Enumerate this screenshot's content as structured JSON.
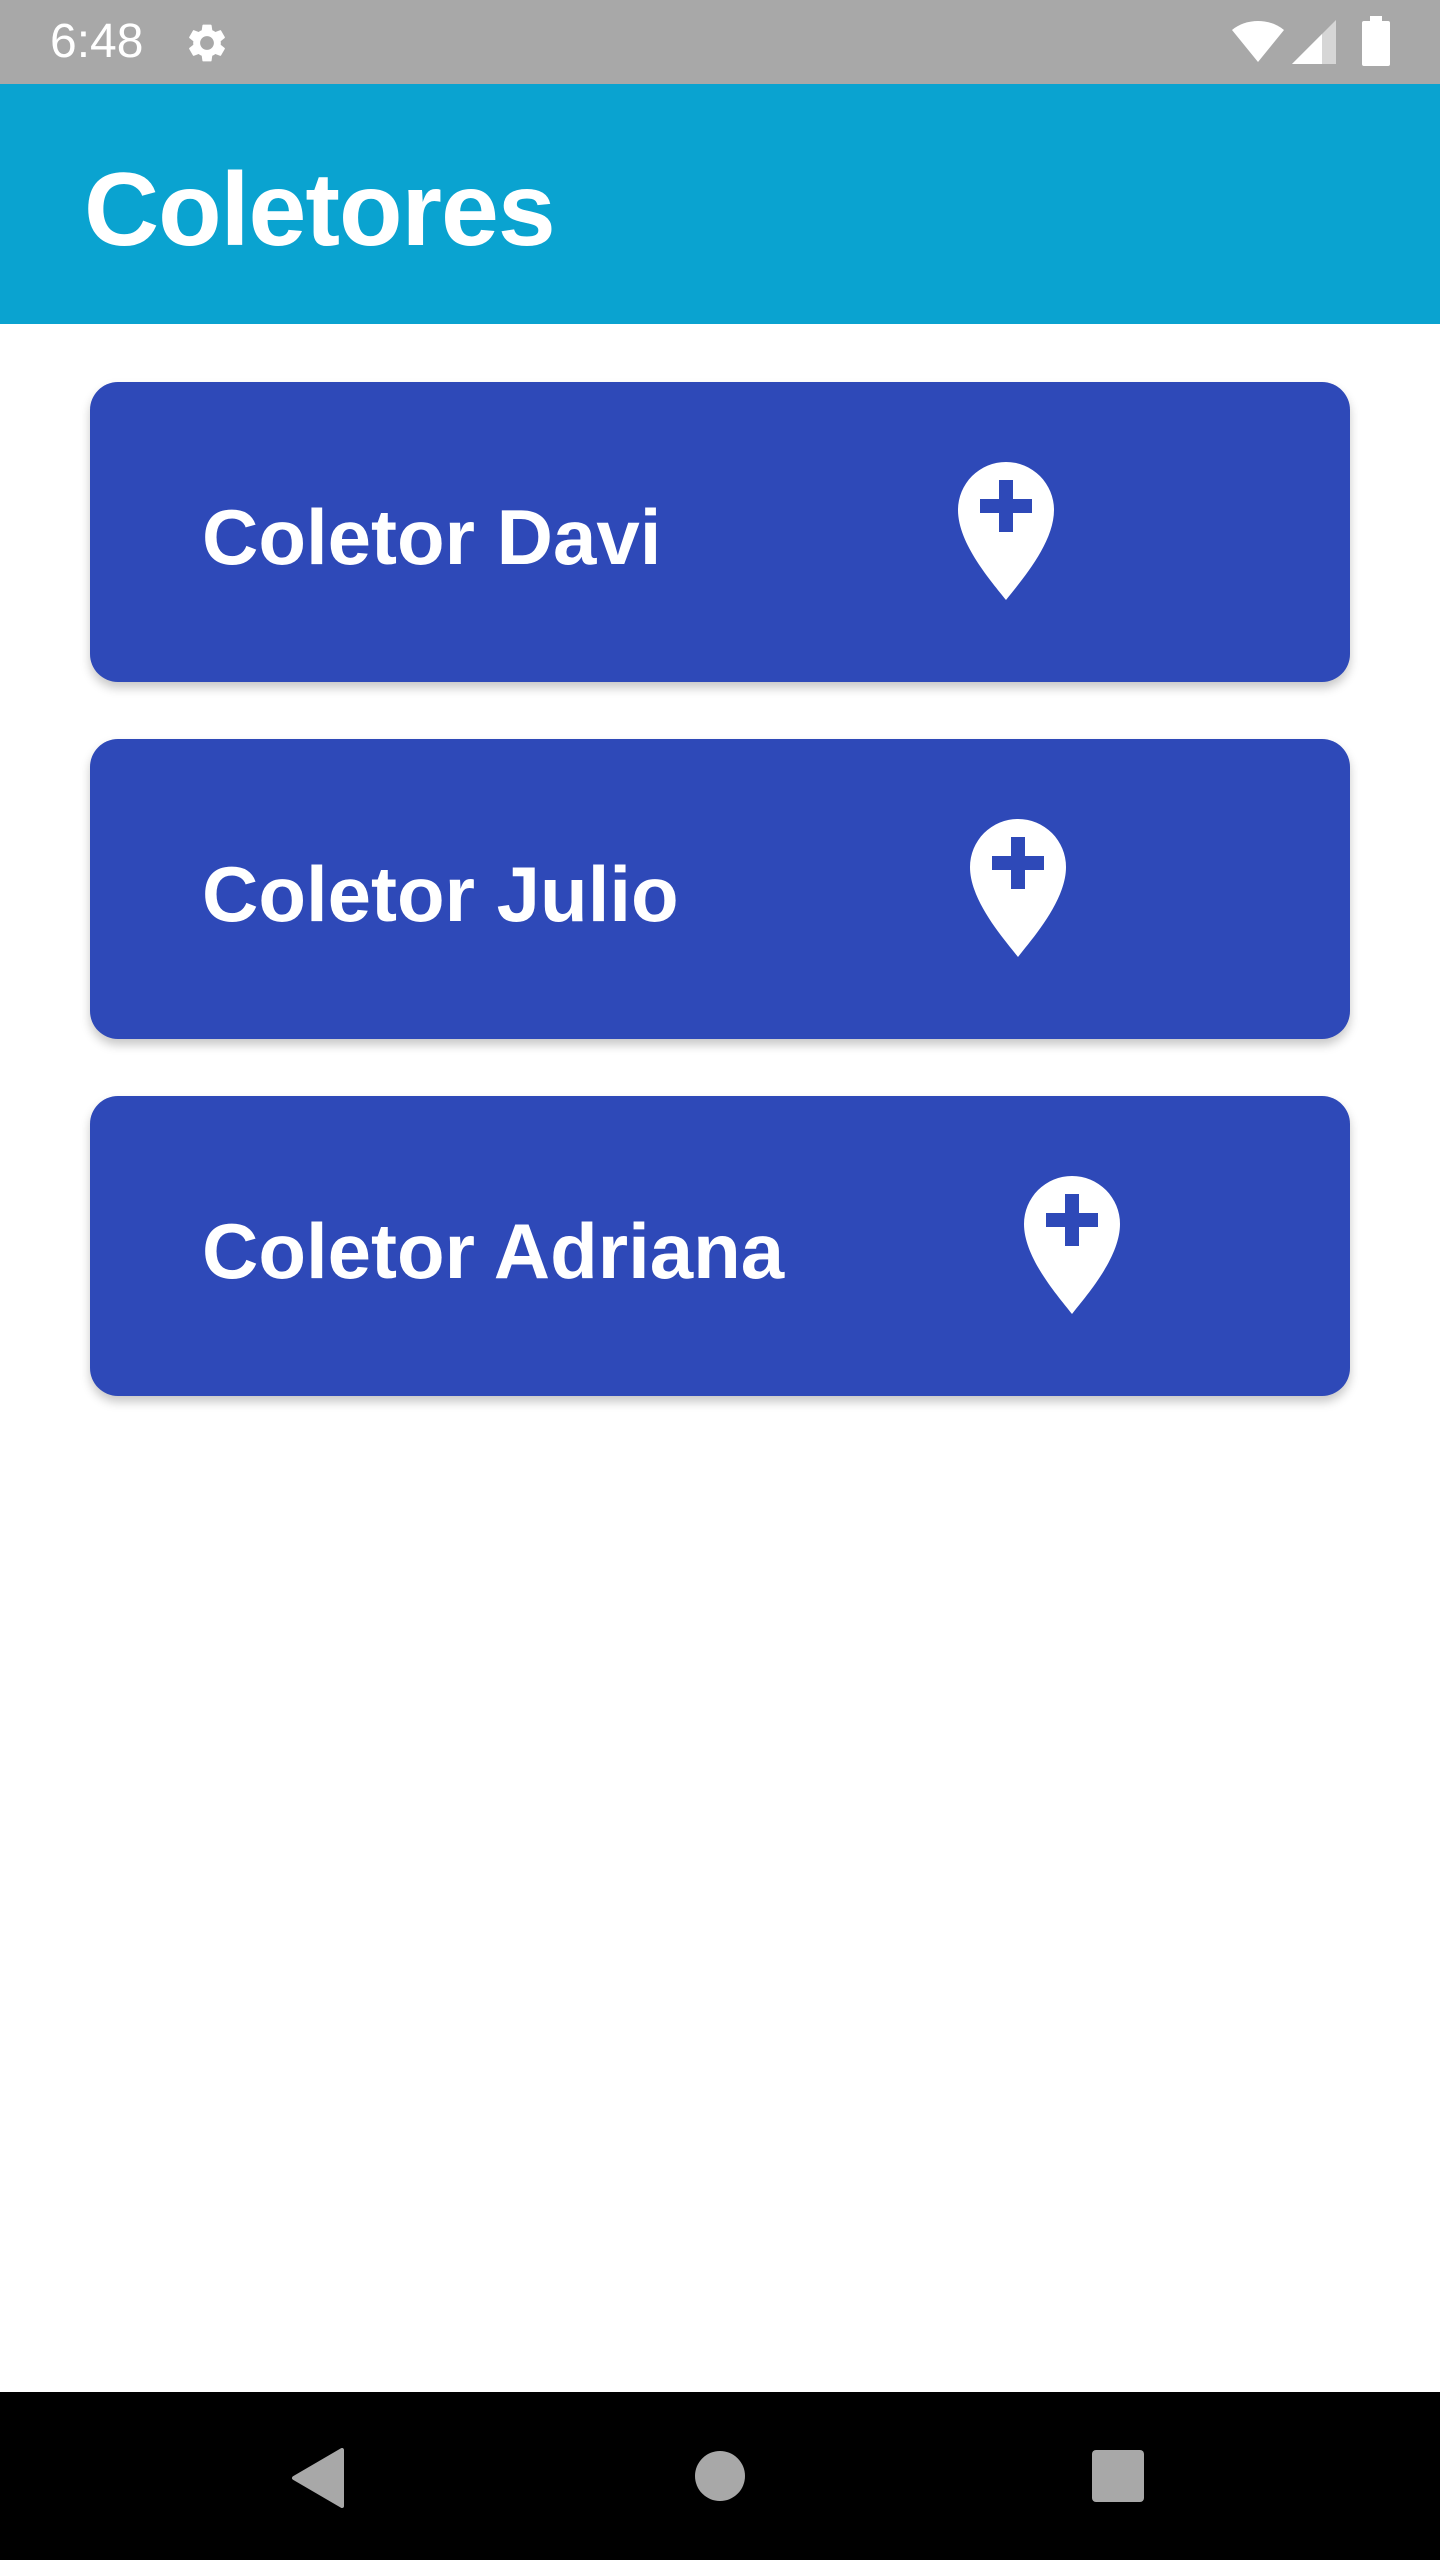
{
  "status_bar": {
    "time": "6:48",
    "icons": [
      "gear-icon",
      "wifi-icon",
      "cell-signal-icon",
      "battery-icon"
    ]
  },
  "app_bar": {
    "title": "Coletores",
    "color": "#0aa3d0"
  },
  "collectors": [
    {
      "label": "Coletor Davi",
      "icon": "add-location-icon"
    },
    {
      "label": "Coletor Julio",
      "icon": "add-location-icon"
    },
    {
      "label": "Coletor Adriana",
      "icon": "add-location-icon"
    }
  ],
  "colors": {
    "card": "#2e49b8",
    "status_bar": "#a8a8a8",
    "text": "#ffffff"
  },
  "nav_bar": {
    "buttons": [
      "back-icon",
      "home-icon",
      "recents-icon"
    ]
  }
}
